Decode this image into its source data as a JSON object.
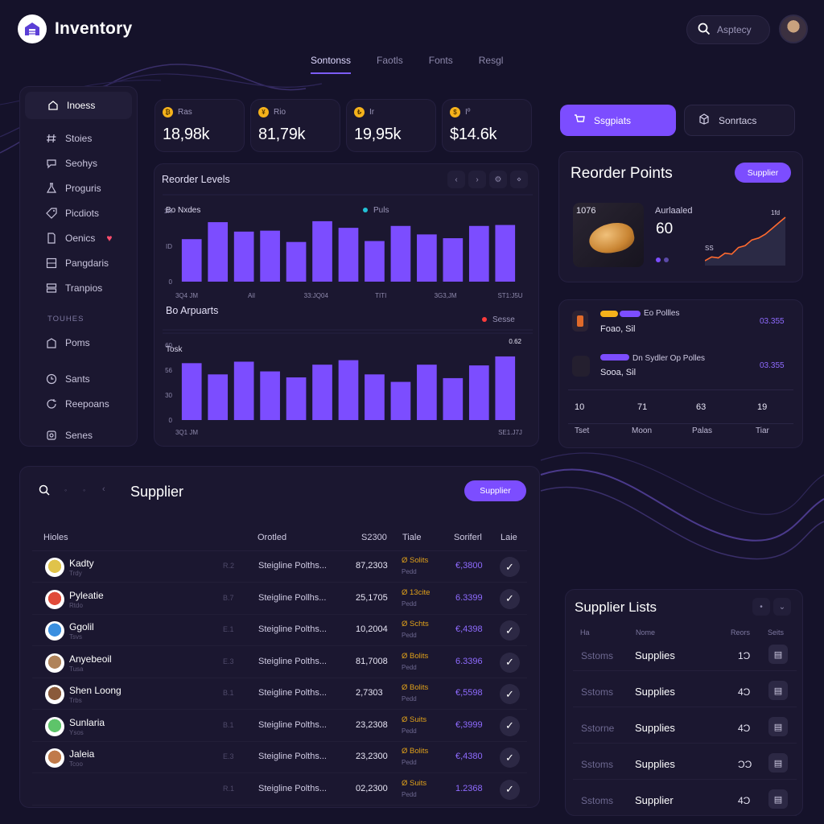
{
  "app": {
    "title": "Inventory"
  },
  "search": {
    "placeholder": "Asptecy"
  },
  "top_tabs": [
    {
      "label": "Sontonss",
      "active": true
    },
    {
      "label": "Faotls"
    },
    {
      "label": "Fonts"
    },
    {
      "label": "Resgl"
    }
  ],
  "sidebar": {
    "items": [
      {
        "label": "Inoess",
        "icon": "home-icon",
        "active": true
      },
      {
        "label": "Stoies",
        "icon": "hash-icon"
      },
      {
        "label": "Seohys",
        "icon": "chat-icon"
      },
      {
        "label": "Proguris",
        "icon": "flask-icon"
      },
      {
        "label": "Picdiots",
        "icon": "tag-icon"
      },
      {
        "label": "Oenics",
        "icon": "doc-icon",
        "badge": "♥"
      },
      {
        "label": "Pangdaris",
        "icon": "grid-icon"
      },
      {
        "label": "Tranpios",
        "icon": "layers-icon"
      }
    ],
    "section_label": "TOUHES",
    "section_items": [
      {
        "label": "Poms",
        "icon": "building-icon"
      },
      {
        "label": "Sants",
        "icon": "clock-icon"
      },
      {
        "label": "Reepoans",
        "icon": "refresh-icon"
      },
      {
        "label": "Senes",
        "icon": "settings-icon"
      }
    ]
  },
  "stats": [
    {
      "label": "Ras",
      "value": "18,98k",
      "icon": "coin-icon"
    },
    {
      "label": "Rio",
      "value": "81,79k",
      "icon": "coin-icon"
    },
    {
      "label": "Ir",
      "value": "19,95k",
      "icon": "coin-icon"
    },
    {
      "label": "Iº",
      "value": "$14.6k",
      "icon": "coin-icon"
    }
  ],
  "chart_data": [
    {
      "type": "bar",
      "title": "Reorder Levels",
      "series_label": "Bo Nxdes",
      "legend": "Puls",
      "yticks": [
        "1R",
        "ID",
        "0"
      ],
      "xticks": [
        "3Q4 JM",
        "Ail",
        "33:JQ04",
        "TITI",
        "3G3,JM",
        "ST1:J5U"
      ],
      "values": [
        45,
        63,
        53,
        54,
        42,
        64,
        57,
        43,
        59,
        50,
        46,
        59,
        60
      ],
      "ylim": [
        0,
        75
      ]
    },
    {
      "type": "bar",
      "title": "Bo Arpuarts",
      "series_label": "Tosk",
      "legend": "Sesse",
      "peak_label": "0.62",
      "yticks": [
        "60",
        "56",
        "30",
        "0"
      ],
      "xticks": [
        "3Q1 JM",
        "SE1.J7J"
      ],
      "values": [
        76,
        61,
        78,
        65,
        57,
        74,
        80,
        61,
        51,
        74,
        56,
        73,
        85
      ],
      "ylim": [
        0,
        100
      ]
    }
  ],
  "actions": {
    "primary": "Ssgpiats",
    "secondary": "Sonrtacs"
  },
  "reorder": {
    "title": "Reorder Points",
    "button": "Supplier",
    "product_label": "1076",
    "metric_label": "Aurlaaled",
    "metric_value": "60",
    "spark_top": "1fd",
    "spark_bottom": "SS",
    "spark_data": [
      6,
      10,
      9,
      14,
      13,
      20,
      22,
      28,
      30,
      34,
      40,
      46,
      52
    ]
  },
  "activity": {
    "rows": [
      {
        "title": "Eo Pollles",
        "sub": "Foao, Sil",
        "value": "03.355"
      },
      {
        "title": "Dn Sydler Op Polles",
        "sub": "Sooa, Sil",
        "value": "03.355"
      }
    ],
    "stats": [
      {
        "value": "10",
        "label": "Tset"
      },
      {
        "value": "71",
        "label": "Moon"
      },
      {
        "value": "63",
        "label": "Palas"
      },
      {
        "value": "19",
        "label": "Tiar"
      }
    ]
  },
  "supplier": {
    "title": "Supplier",
    "button": "Supplier",
    "columns": [
      "Hioles",
      "Orotled",
      "S2300",
      "Tiale",
      "Soriferl",
      "Laie"
    ],
    "rows": [
      {
        "name": "Kadty",
        "sub": "Trdy",
        "code": "R.2",
        "desc": "Steigline Polths...",
        "num": "87,2303",
        "status": "Ø Solits",
        "status_sub": "Pedd",
        "amount": "€,3800",
        "avatar": "#e0c34a"
      },
      {
        "name": "Pyleatie",
        "sub": "Rtdo",
        "code": "B.7",
        "desc": "Steigline Pollhs...",
        "num": "25,1705",
        "status": "Ø 13cite",
        "status_sub": "Pedd",
        "amount": "6.3399",
        "avatar": "#e04b3a"
      },
      {
        "name": "Ggolil",
        "sub": "Tsvs",
        "code": "E.1",
        "desc": "Steigline Polths...",
        "num": "10,2004",
        "status": "Ø Schts",
        "status_sub": "Pedd",
        "amount": "€,4398",
        "avatar": "#3a8fe0"
      },
      {
        "name": "Anyebeoil",
        "sub": "Tusa",
        "code": "E.3",
        "desc": "Steigline Polths...",
        "num": "81,7008",
        "status": "Ø Bolits",
        "status_sub": "Pedd",
        "amount": "6.3396",
        "avatar": "#b0835a"
      },
      {
        "name": "Shen Loong",
        "sub": "Trbs",
        "code": "B.1",
        "desc": "Steigline Polths...",
        "num": "2,7303",
        "status": "Ø Bolits",
        "status_sub": "Pedd",
        "amount": "€,5598",
        "avatar": "#8a5a3a"
      },
      {
        "name": "Sunlaria",
        "sub": "Ysos",
        "code": "B.1",
        "desc": "Steigline Polths...",
        "num": "23,2308",
        "status": "Ø Suits",
        "status_sub": "Pedd",
        "amount": "€,3999",
        "avatar": "#5ec46a"
      },
      {
        "name": "Jaleia",
        "sub": "Tcoo",
        "code": "E.3",
        "desc": "Steigline Polths...",
        "num": "23,2300",
        "status": "Ø Bolits",
        "status_sub": "Pedd",
        "amount": "€,4380",
        "avatar": "#c07a4a"
      },
      {
        "name": "",
        "sub": "",
        "code": "R.1",
        "desc": "Steigline Polths...",
        "num": "02,2300",
        "status": "Ø Suits",
        "status_sub": "Pedd",
        "amount": "1.2368",
        "avatar": ""
      }
    ]
  },
  "supplier_lists": {
    "title": "Supplier Lists",
    "columns": [
      "Ha",
      "Nome",
      "Reors",
      "Seits"
    ],
    "rows": [
      {
        "a": "Sstoms",
        "b": "Supplies",
        "c": "1Ͻ"
      },
      {
        "a": "Sstoms",
        "b": "Supplies",
        "c": "4Ͻ"
      },
      {
        "a": "Sstorne",
        "b": "Supplies",
        "c": "4Ͻ"
      },
      {
        "a": "Sstoms",
        "b": "Supplies",
        "c": "ϽϽ"
      },
      {
        "a": "Sstoms",
        "b": "Supplier",
        "c": "4Ͻ"
      }
    ]
  },
  "colors": {
    "accent": "#7c4dff",
    "bar": "#7c4dff",
    "background": "#15122a",
    "panel": "#1b1730",
    "coin": "#f5b21b"
  }
}
